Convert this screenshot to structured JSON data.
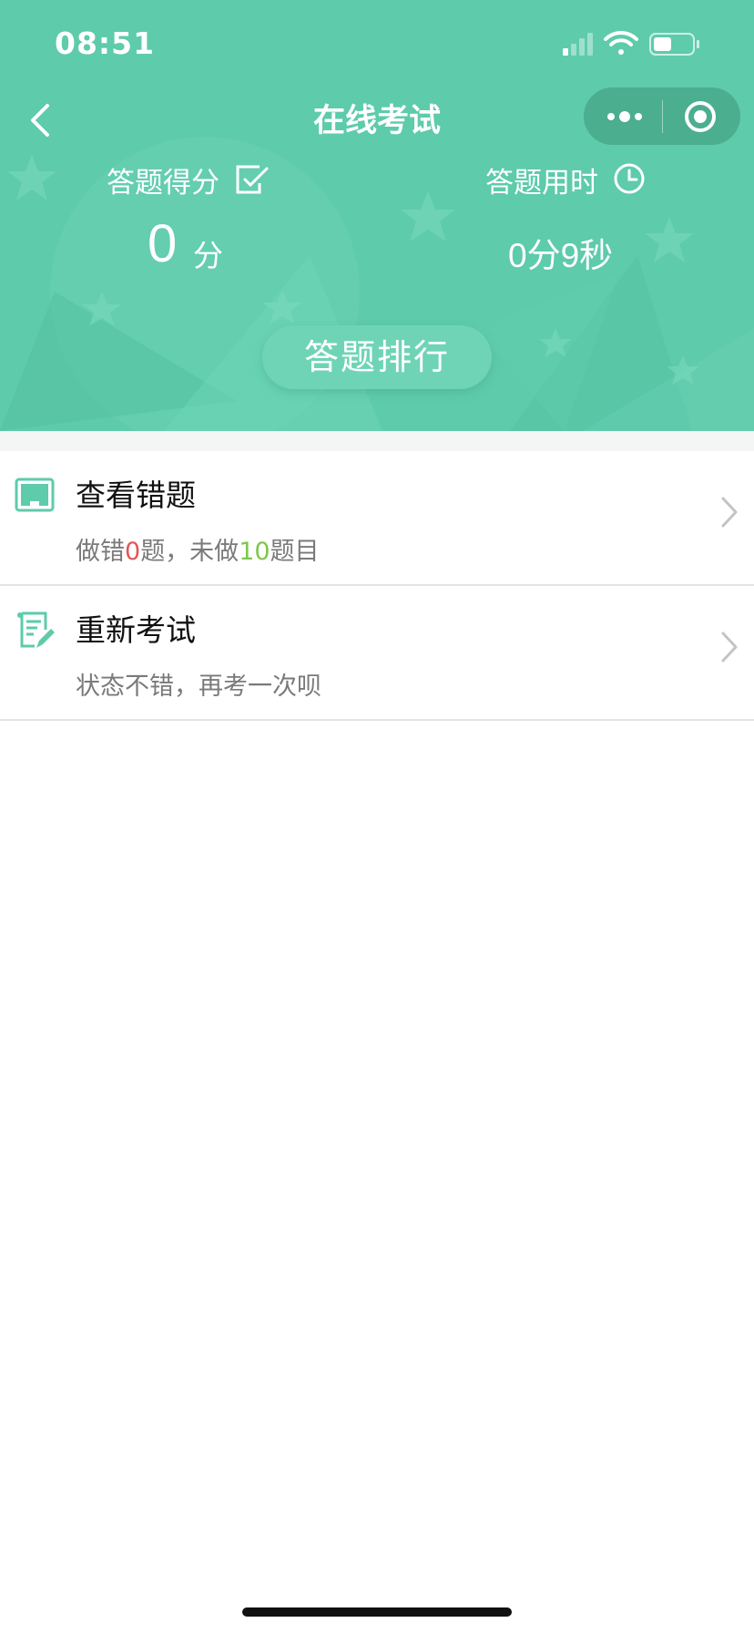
{
  "status_bar": {
    "time": "08:51"
  },
  "nav": {
    "title": "在线考试"
  },
  "stats": {
    "score_label": "答题得分",
    "score_value": "0",
    "score_unit": "分",
    "time_label": "答题用时",
    "time_value": "0分9秒"
  },
  "rank_button": {
    "label": "答题排行"
  },
  "list": [
    {
      "title": "查看错题",
      "sub_prefix": "做错",
      "wrong_count": "0",
      "sub_middle": "题，未做",
      "undone_count": "10",
      "sub_suffix": "题目"
    },
    {
      "title": "重新考试",
      "sub": "状态不错，再考一次呗"
    }
  ],
  "colors": {
    "header_green": "#5ecbaa",
    "accent_red": "#e25757",
    "accent_green": "#7fc74a"
  },
  "icons": [
    "back-arrow-icon",
    "more-dots-icon",
    "target-icon",
    "checkbox-edit-icon",
    "clock-icon",
    "screen-icon",
    "note-edit-icon",
    "chevron-right-icon",
    "signal-icon",
    "wifi-icon",
    "battery-icon"
  ]
}
